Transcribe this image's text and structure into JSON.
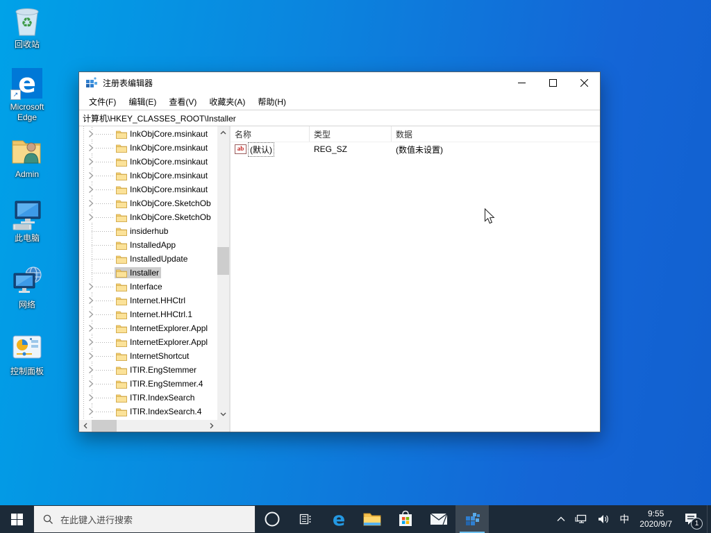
{
  "desktop": {
    "icons": [
      {
        "label": "回收站"
      },
      {
        "label": "Microsoft Edge"
      },
      {
        "label": "Admin"
      },
      {
        "label": "此电脑"
      },
      {
        "label": "网络"
      },
      {
        "label": "控制面板"
      }
    ]
  },
  "window": {
    "title": "注册表编辑器",
    "menu": [
      "文件(F)",
      "编辑(E)",
      "查看(V)",
      "收藏夹(A)",
      "帮助(H)"
    ],
    "address": "计算机\\HKEY_CLASSES_ROOT\\Installer",
    "tree": {
      "items": [
        {
          "label": "InkObjCore.msinkaut",
          "chevron": true,
          "selected": false
        },
        {
          "label": "InkObjCore.msinkaut",
          "chevron": true,
          "selected": false
        },
        {
          "label": "InkObjCore.msinkaut",
          "chevron": true,
          "selected": false
        },
        {
          "label": "InkObjCore.msinkaut",
          "chevron": true,
          "selected": false
        },
        {
          "label": "InkObjCore.msinkaut",
          "chevron": true,
          "selected": false
        },
        {
          "label": "InkObjCore.SketchOb",
          "chevron": true,
          "selected": false
        },
        {
          "label": "InkObjCore.SketchOb",
          "chevron": true,
          "selected": false
        },
        {
          "label": "insiderhub",
          "chevron": false,
          "selected": false
        },
        {
          "label": "InstalledApp",
          "chevron": false,
          "selected": false
        },
        {
          "label": "InstalledUpdate",
          "chevron": false,
          "selected": false
        },
        {
          "label": "Installer",
          "chevron": false,
          "selected": true
        },
        {
          "label": "Interface",
          "chevron": true,
          "selected": false
        },
        {
          "label": "Internet.HHCtrl",
          "chevron": true,
          "selected": false
        },
        {
          "label": "Internet.HHCtrl.1",
          "chevron": true,
          "selected": false
        },
        {
          "label": "InternetExplorer.Appl",
          "chevron": true,
          "selected": false
        },
        {
          "label": "InternetExplorer.Appl",
          "chevron": true,
          "selected": false
        },
        {
          "label": "InternetShortcut",
          "chevron": true,
          "selected": false
        },
        {
          "label": "ITIR.EngStemmer",
          "chevron": true,
          "selected": false
        },
        {
          "label": "ITIR.EngStemmer.4",
          "chevron": true,
          "selected": false
        },
        {
          "label": "ITIR.IndexSearch",
          "chevron": true,
          "selected": false
        },
        {
          "label": "ITIR.IndexSearch.4",
          "chevron": true,
          "selected": false
        }
      ]
    },
    "list": {
      "columns": [
        "名称",
        "类型",
        "数据"
      ],
      "rows": [
        {
          "name": "(默认)",
          "type": "REG_SZ",
          "data": "(数值未设置)"
        }
      ]
    }
  },
  "taskbar": {
    "search_placeholder": "在此键入进行搜索",
    "ime_indicator": "中",
    "clock": {
      "time": "9:55",
      "date": "2020/9/7"
    },
    "notification_count": "1"
  },
  "colors": {
    "accent": "#0078d7",
    "desktop_left": "#00a2e8",
    "desktop_right": "#1160cf",
    "taskbar": "#1c2a38",
    "tree_selection": "#cccccc",
    "reg_sz_icon_red": "#c11b17"
  }
}
